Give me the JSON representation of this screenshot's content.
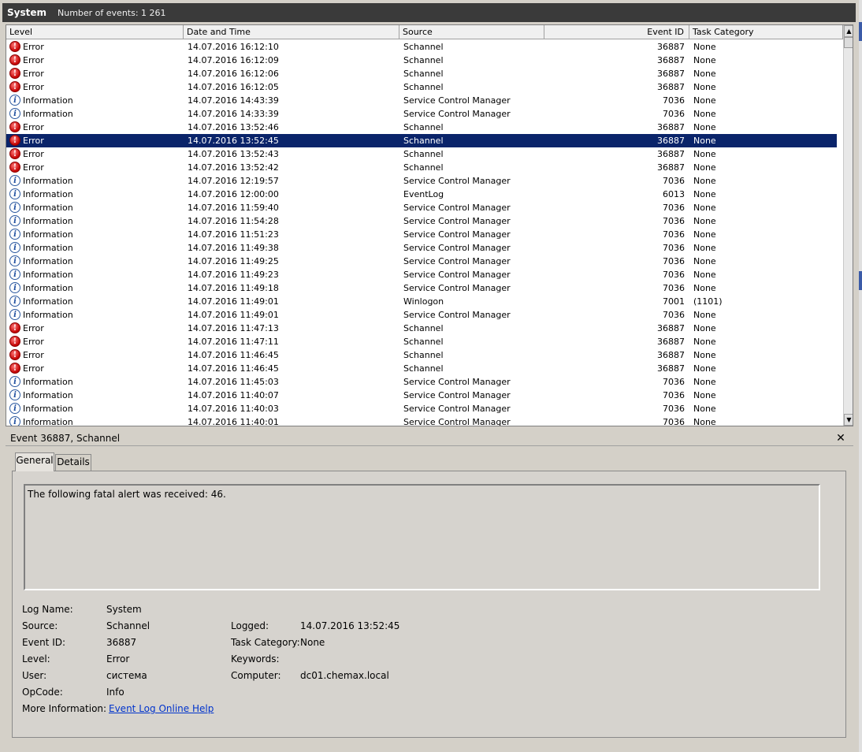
{
  "header": {
    "log_name": "System",
    "event_count": "Number of events: 1 261"
  },
  "columns": [
    "Level",
    "Date and Time",
    "Source",
    "Event ID",
    "Task Category"
  ],
  "rows": [
    {
      "level": "Error",
      "date": "14.07.2016 16:12:10",
      "source": "Schannel",
      "event_id": "36887",
      "task": "None"
    },
    {
      "level": "Error",
      "date": "14.07.2016 16:12:09",
      "source": "Schannel",
      "event_id": "36887",
      "task": "None"
    },
    {
      "level": "Error",
      "date": "14.07.2016 16:12:06",
      "source": "Schannel",
      "event_id": "36887",
      "task": "None"
    },
    {
      "level": "Error",
      "date": "14.07.2016 16:12:05",
      "source": "Schannel",
      "event_id": "36887",
      "task": "None"
    },
    {
      "level": "Information",
      "date": "14.07.2016 14:43:39",
      "source": "Service Control Manager",
      "event_id": "7036",
      "task": "None"
    },
    {
      "level": "Information",
      "date": "14.07.2016 14:33:39",
      "source": "Service Control Manager",
      "event_id": "7036",
      "task": "None"
    },
    {
      "level": "Error",
      "date": "14.07.2016 13:52:46",
      "source": "Schannel",
      "event_id": "36887",
      "task": "None"
    },
    {
      "level": "Error",
      "date": "14.07.2016 13:52:45",
      "source": "Schannel",
      "event_id": "36887",
      "task": "None",
      "selected": true
    },
    {
      "level": "Error",
      "date": "14.07.2016 13:52:43",
      "source": "Schannel",
      "event_id": "36887",
      "task": "None"
    },
    {
      "level": "Error",
      "date": "14.07.2016 13:52:42",
      "source": "Schannel",
      "event_id": "36887",
      "task": "None"
    },
    {
      "level": "Information",
      "date": "14.07.2016 12:19:57",
      "source": "Service Control Manager",
      "event_id": "7036",
      "task": "None"
    },
    {
      "level": "Information",
      "date": "14.07.2016 12:00:00",
      "source": "EventLog",
      "event_id": "6013",
      "task": "None"
    },
    {
      "level": "Information",
      "date": "14.07.2016 11:59:40",
      "source": "Service Control Manager",
      "event_id": "7036",
      "task": "None"
    },
    {
      "level": "Information",
      "date": "14.07.2016 11:54:28",
      "source": "Service Control Manager",
      "event_id": "7036",
      "task": "None"
    },
    {
      "level": "Information",
      "date": "14.07.2016 11:51:23",
      "source": "Service Control Manager",
      "event_id": "7036",
      "task": "None"
    },
    {
      "level": "Information",
      "date": "14.07.2016 11:49:38",
      "source": "Service Control Manager",
      "event_id": "7036",
      "task": "None"
    },
    {
      "level": "Information",
      "date": "14.07.2016 11:49:25",
      "source": "Service Control Manager",
      "event_id": "7036",
      "task": "None"
    },
    {
      "level": "Information",
      "date": "14.07.2016 11:49:23",
      "source": "Service Control Manager",
      "event_id": "7036",
      "task": "None"
    },
    {
      "level": "Information",
      "date": "14.07.2016 11:49:18",
      "source": "Service Control Manager",
      "event_id": "7036",
      "task": "None"
    },
    {
      "level": "Information",
      "date": "14.07.2016 11:49:01",
      "source": "Winlogon",
      "event_id": "7001",
      "task": "(1101)"
    },
    {
      "level": "Information",
      "date": "14.07.2016 11:49:01",
      "source": "Service Control Manager",
      "event_id": "7036",
      "task": "None"
    },
    {
      "level": "Error",
      "date": "14.07.2016 11:47:13",
      "source": "Schannel",
      "event_id": "36887",
      "task": "None"
    },
    {
      "level": "Error",
      "date": "14.07.2016 11:47:11",
      "source": "Schannel",
      "event_id": "36887",
      "task": "None"
    },
    {
      "level": "Error",
      "date": "14.07.2016 11:46:45",
      "source": "Schannel",
      "event_id": "36887",
      "task": "None"
    },
    {
      "level": "Error",
      "date": "14.07.2016 11:46:45",
      "source": "Schannel",
      "event_id": "36887",
      "task": "None"
    },
    {
      "level": "Information",
      "date": "14.07.2016 11:45:03",
      "source": "Service Control Manager",
      "event_id": "7036",
      "task": "None"
    },
    {
      "level": "Information",
      "date": "14.07.2016 11:40:07",
      "source": "Service Control Manager",
      "event_id": "7036",
      "task": "None"
    },
    {
      "level": "Information",
      "date": "14.07.2016 11:40:03",
      "source": "Service Control Manager",
      "event_id": "7036",
      "task": "None"
    },
    {
      "level": "Information",
      "date": "14.07.2016 11:40:01",
      "source": "Service Control Manager",
      "event_id": "7036",
      "task": "None"
    }
  ],
  "icons": {
    "error": "error-circle-icon",
    "information": "information-circle-icon",
    "close": "close-icon",
    "scroll_up": "scroll-up-arrow-icon",
    "scroll_down": "scroll-down-arrow-icon"
  },
  "colors": {
    "selection": "#0a246a",
    "title_bar": "#3a3a3a",
    "error_red": "#c40000",
    "info_blue": "#1f4fa0",
    "link": "#0033cc"
  },
  "detail": {
    "title": "Event 36887, Schannel",
    "tabs": [
      "General",
      "Details"
    ],
    "active_tab": "General",
    "description": "The following fatal alert was received: 46.",
    "labels": {
      "log_name": "Log Name:",
      "source": "Source:",
      "event_id": "Event ID:",
      "level": "Level:",
      "user": "User:",
      "opcode": "OpCode:",
      "more_info": "More Information:",
      "logged": "Logged:",
      "task_category": "Task Category:",
      "keywords": "Keywords:",
      "computer": "Computer:"
    },
    "values": {
      "log_name": "System",
      "source": "Schannel",
      "event_id": "36887",
      "level": "Error",
      "user": "система",
      "opcode": "Info",
      "more_info": "Event Log Online Help",
      "logged": "14.07.2016 13:52:45",
      "task_category": "None",
      "keywords": "",
      "computer": "dc01.chemax.local"
    }
  }
}
